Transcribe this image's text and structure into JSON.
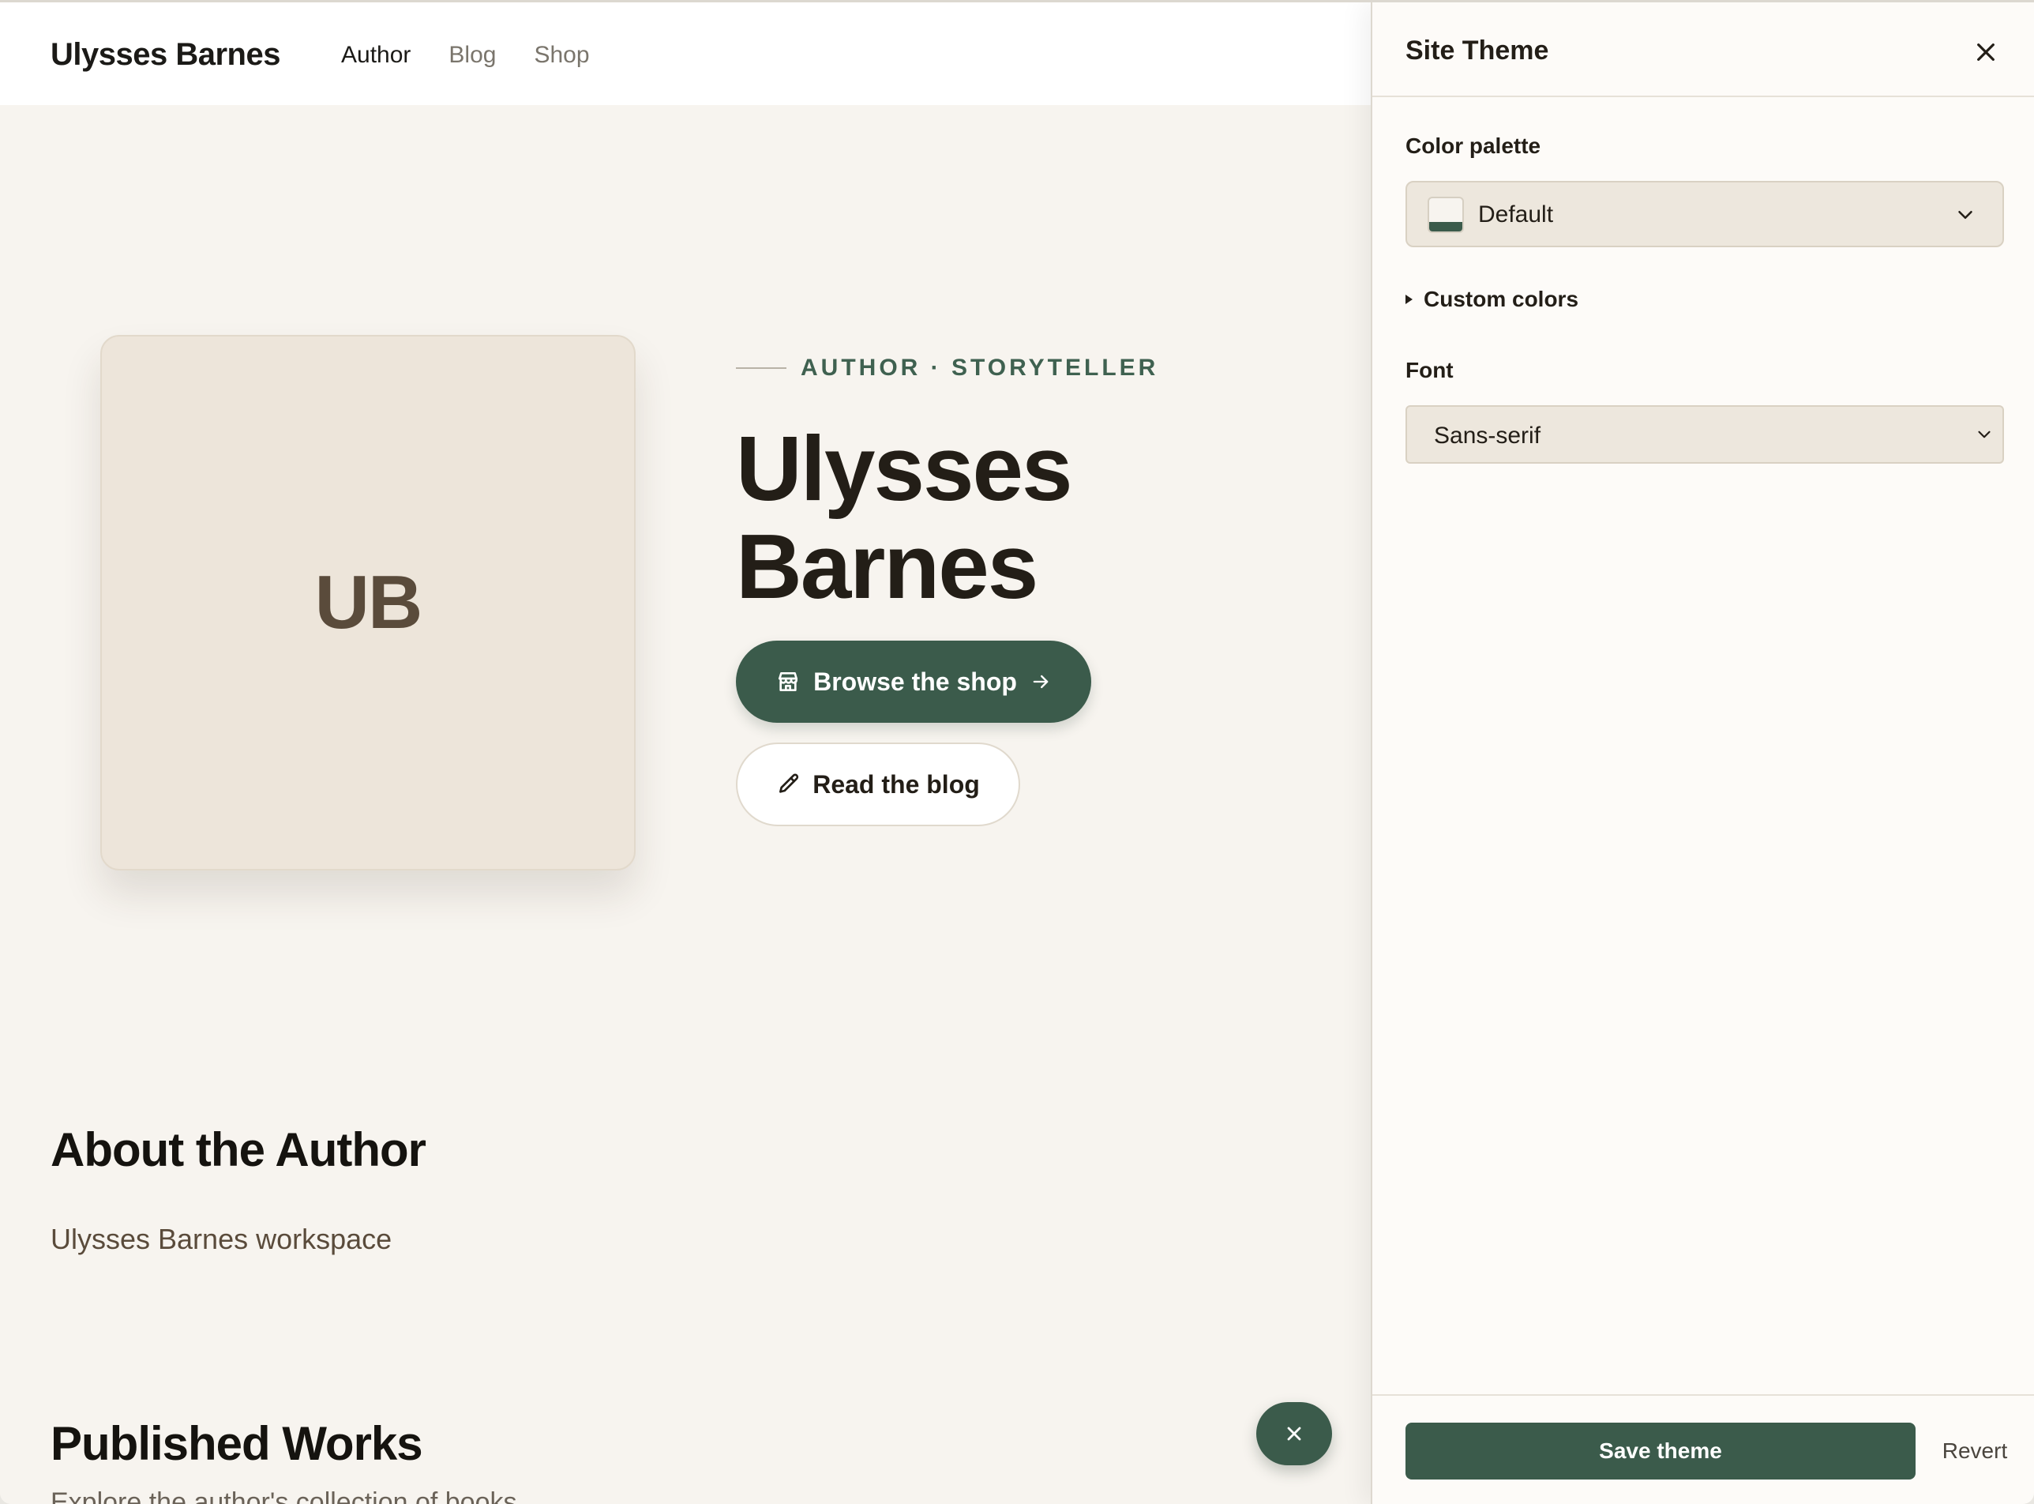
{
  "site": {
    "brand": "Ulysses Barnes",
    "nav": [
      {
        "label": "Author",
        "active": true
      },
      {
        "label": "Blog",
        "active": false
      },
      {
        "label": "Shop",
        "active": false
      }
    ],
    "hero": {
      "initials": "UB",
      "eyebrow": "AUTHOR · STORYTELLER",
      "name_line1": "Ulysses",
      "name_line2": "Barnes",
      "primary_cta": "Browse the shop",
      "secondary_cta": "Read the blog"
    },
    "about": {
      "title": "About the Author",
      "text": "Ulysses Barnes workspace"
    },
    "works": {
      "title": "Published Works",
      "text": "Explore the author's collection of books"
    }
  },
  "panel": {
    "title": "Site Theme",
    "palette_label": "Color palette",
    "palette_value": "Default",
    "custom_colors_label": "Custom colors",
    "font_label": "Font",
    "font_value": "Sans-serif",
    "save_label": "Save theme",
    "revert_label": "Revert"
  },
  "colors": {
    "accent": "#3b5b4b",
    "background": "#f7f4ef",
    "text": "#231e17"
  },
  "icons": {
    "shop": "storefront-icon",
    "arrow": "arrow-right-icon",
    "blog": "pencil-icon",
    "close": "close-icon",
    "chevron": "chevron-down-icon"
  }
}
